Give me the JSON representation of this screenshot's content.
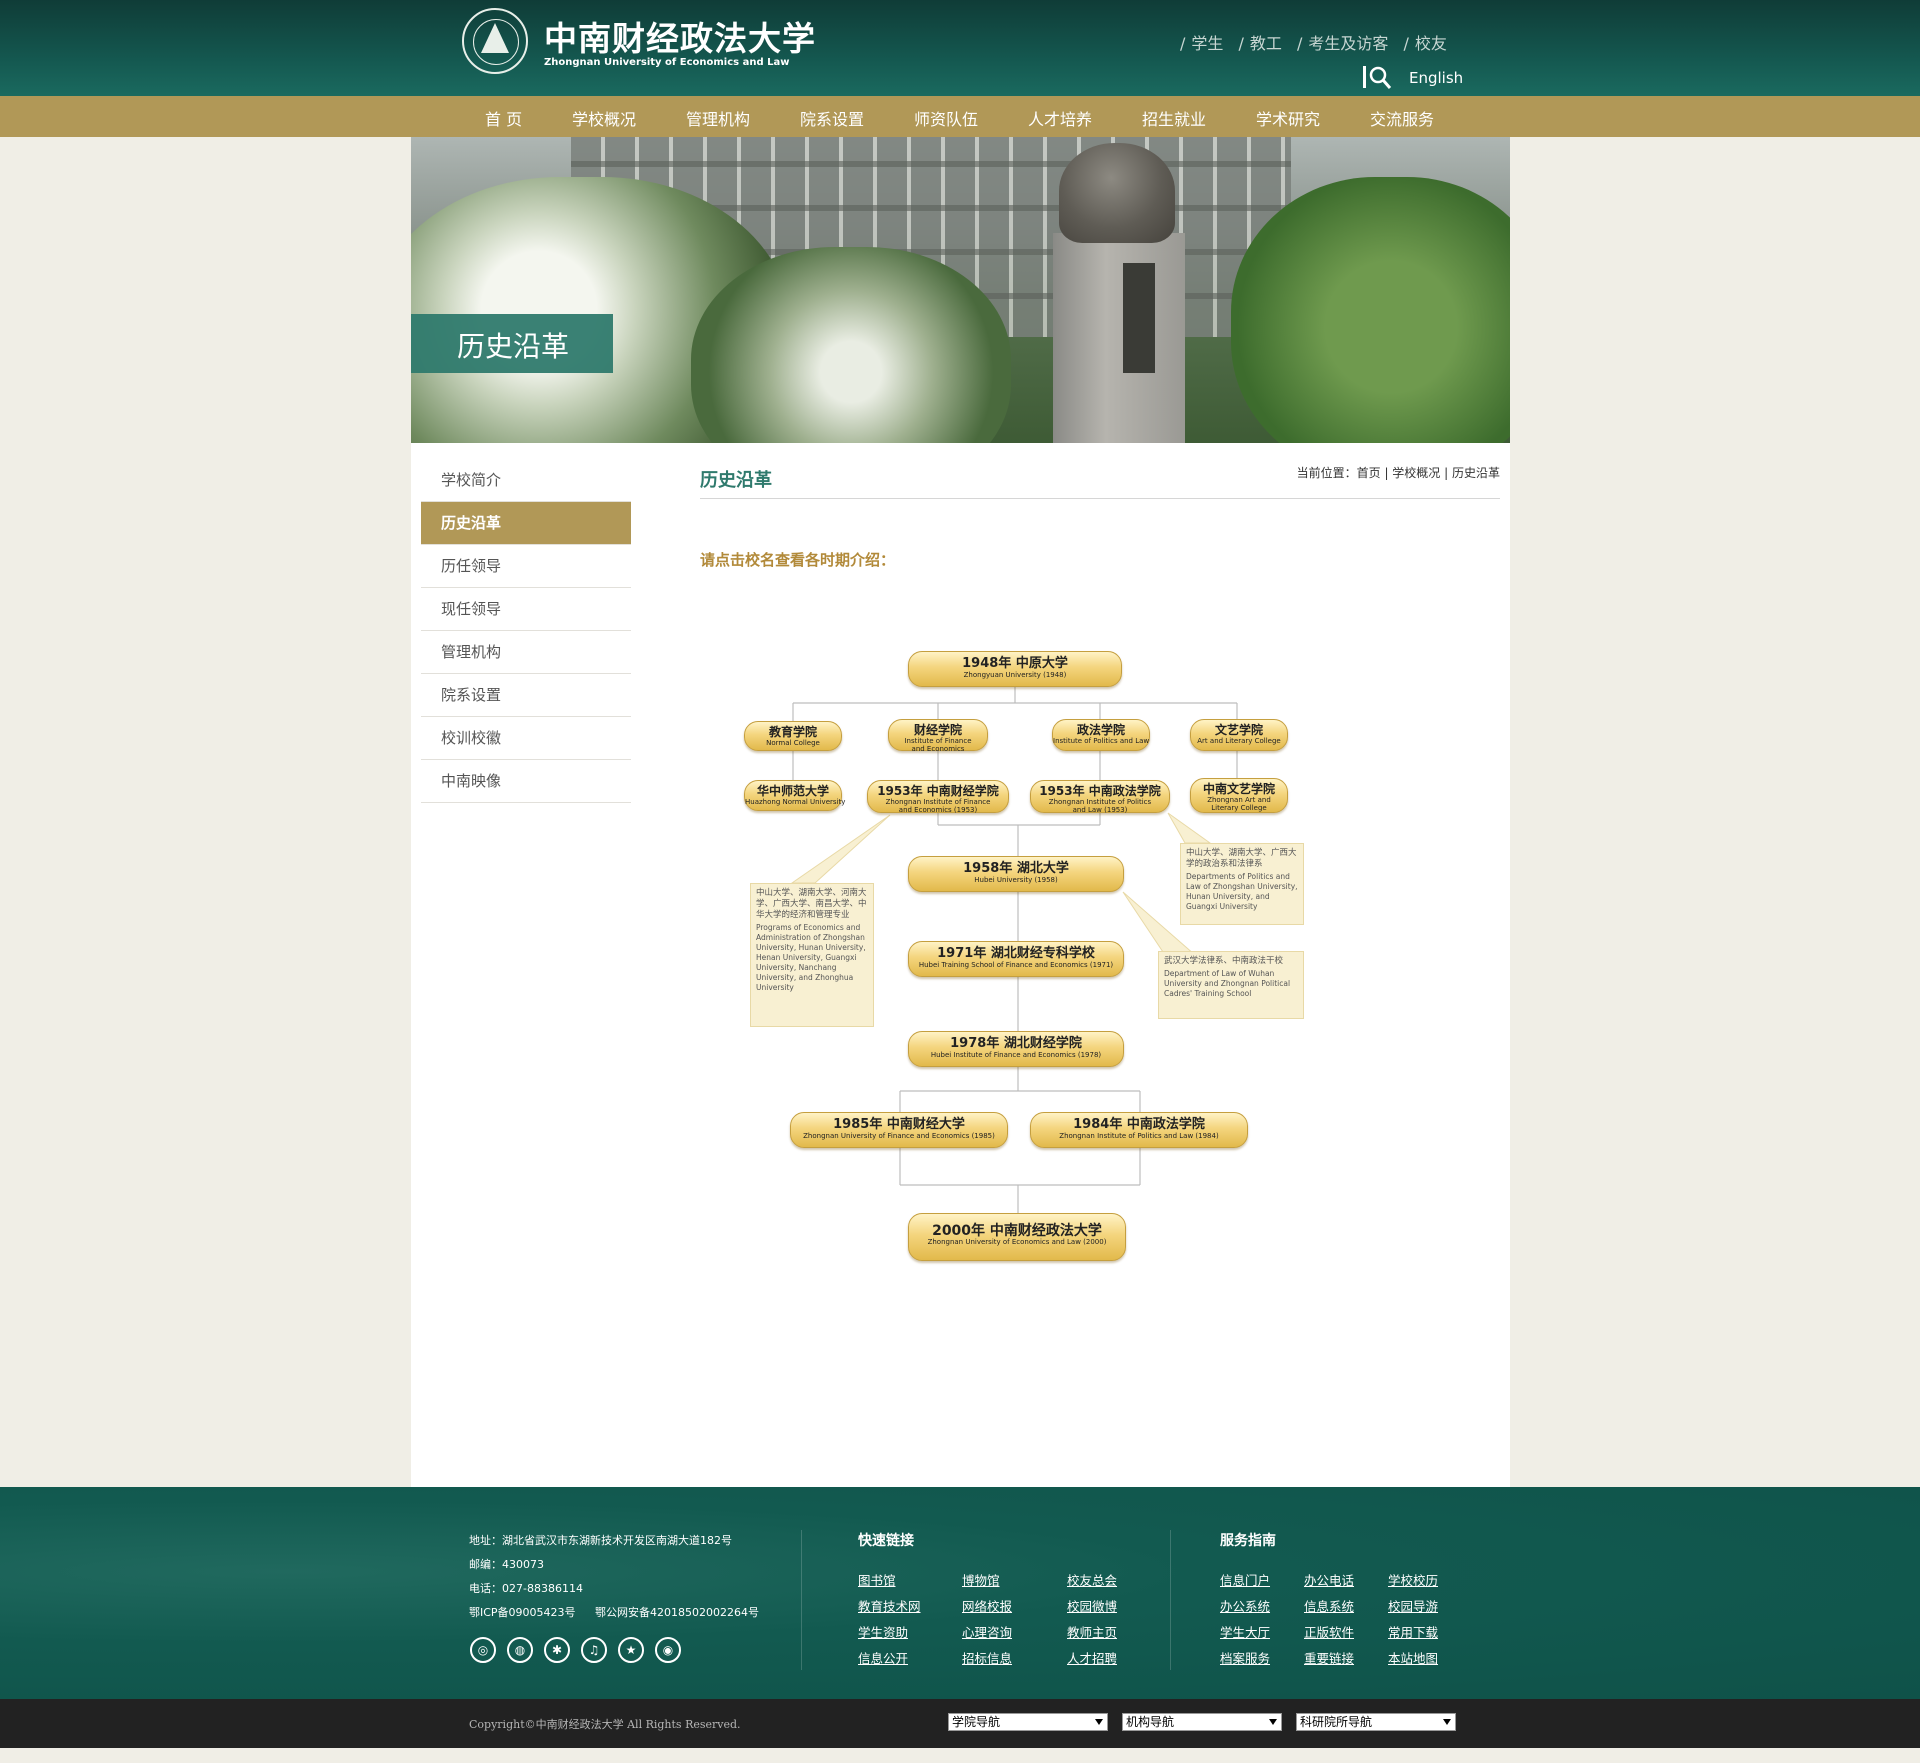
{
  "header": {
    "logo_cn": "中南财经政法大学",
    "logo_en": "Zhongnan University of Economics and Law",
    "top_links": [
      "学生",
      "教工",
      "考生及访客",
      "校友"
    ],
    "lang": "English"
  },
  "nav": [
    "首 页",
    "学校概况",
    "管理机构",
    "院系设置",
    "师资队伍",
    "人才培养",
    "招生就业",
    "学术研究",
    "交流服务"
  ],
  "banner": {
    "title": "历史沿革"
  },
  "sidebar": {
    "items": [
      "学校简介",
      "历史沿革",
      "历任领导",
      "现任领导",
      "管理机构",
      "院系设置",
      "校训校徽",
      "中南映像"
    ],
    "active_index": 1
  },
  "content": {
    "title": "历史沿革",
    "breadcrumb_prefix": "当前位置：",
    "breadcrumb": [
      "首页",
      "学校概况",
      "历史沿革"
    ],
    "intro": "请点击校名查看各时期介绍："
  },
  "timeline": {
    "nodes": [
      {
        "cn": "1948年 中原大学",
        "en": "Zhongyuan University (1948)"
      },
      {
        "cn": "教育学院",
        "en": "Normal College"
      },
      {
        "cn": "财经学院",
        "en": "Institute of Finance and Economics"
      },
      {
        "cn": "政法学院",
        "en": "Institute of Politics and Law"
      },
      {
        "cn": "文艺学院",
        "en": "Art and Literary College"
      },
      {
        "cn": "华中师范大学",
        "en": "Huazhong Normal University"
      },
      {
        "cn": "1953年 中南财经学院",
        "en": "Zhongnan Institute of Finance and Economics (1953)"
      },
      {
        "cn": "1953年 中南政法学院",
        "en": "Zhongnan Institute of Politics and Law (1953)"
      },
      {
        "cn": "中南文艺学院",
        "en": "Zhongnan Art and Literary College"
      },
      {
        "cn": "1958年 湖北大学",
        "en": "Hubei University (1958)"
      },
      {
        "cn": "1971年 湖北财经专科学校",
        "en": "Hubei Training School of Finance and Economics (1971)"
      },
      {
        "cn": "1978年 湖北财经学院",
        "en": "Hubei Institute of Finance and Economics (1978)"
      },
      {
        "cn": "1985年 中南财经大学",
        "en": "Zhongnan University of Finance and Economics (1985)"
      },
      {
        "cn": "1984年 中南政法学院",
        "en": "Zhongnan Institute of Politics and Law (1984)"
      },
      {
        "cn": "2000年 中南财经政法大学",
        "en": "Zhongnan University of Economics and Law (2000)"
      }
    ],
    "notes": [
      {
        "cn": "中山大学、湖南大学、河南大学、广西大学、南昌大学、中华大学的经济和管理专业",
        "en": "Programs of Economics and Administration of Zhongshan University, Hunan University, Henan University, Guangxi University, Nanchang University, and Zhonghua University"
      },
      {
        "cn": "中山大学、湖南大学、广西大学的政治系和法律系",
        "en": "Departments of Politics and Law of Zhongshan University, Hunan University, and Guangxi University"
      },
      {
        "cn": "武汉大学法律系、中南政法干校",
        "en": "Department of Law of Wuhan University and Zhongnan Political Cadres' Training School"
      }
    ]
  },
  "footer": {
    "address": "地址：湖北省武汉市东湖新技术开发区南湖大道182号",
    "postcode": "邮编：430073",
    "phone": "电话：027-88386114",
    "icp": "鄂ICP备09005423号",
    "police": "鄂公网安备42018502002264号",
    "quick_links_title": "快速链接",
    "quick_links": [
      "图书馆",
      "博物馆",
      "校友总会",
      "教育技术网",
      "网络校报",
      "校园微博",
      "学生资助",
      "心理咨询",
      "教师主页",
      "信息公开",
      "招标信息",
      "人才招聘"
    ],
    "service_title": "服务指南",
    "service_links": [
      "信息门户",
      "办公电话",
      "学校校历",
      "办公系统",
      "信息系统",
      "校园导游",
      "学生大厅",
      "正版软件",
      "常用下载",
      "档案服务",
      "重要链接",
      "本站地图"
    ],
    "social_icons": [
      "weibo-icon",
      "wechat-icon",
      "toutiao-icon",
      "douyin-icon",
      "star-icon",
      "camera-icon"
    ],
    "copyright": "Copyright©中南财经政法大学 All Rights Reserved.",
    "selects": [
      "学院导航",
      "机构导航",
      "科研院所导航"
    ]
  }
}
